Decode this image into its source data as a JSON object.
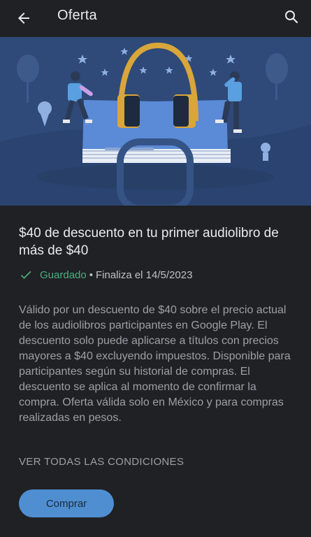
{
  "header": {
    "title": "Oferta",
    "back_icon": "arrow-back-icon",
    "search_icon": "search-icon"
  },
  "offer": {
    "headline": "$40 de descuento en tu primer audiolibro de más de $40",
    "saved_label": "Guardado",
    "separator": "•",
    "ends_label": "Finaliza el 14/5/2023",
    "description": "Válido por un descuento de $40 sobre el precio actual de los audiolibros participantes en Google Play. El descuento solo puede aplicarse a títulos con precios mayores a $40 excluyendo impuestos. Disponible para participantes según su historial de compras. El descuento se aplica al momento de confirmar la compra. Oferta válida solo en México y para compras realizadas en pesos.",
    "terms_link": "VER TODAS LAS CONDICIONES",
    "buy_button": "Comprar"
  },
  "colors": {
    "background": "#202124",
    "banner": "#2f4a78",
    "accent_green": "#4caf82",
    "button": "#4f8ed1",
    "headphones": "#d9a63a"
  }
}
